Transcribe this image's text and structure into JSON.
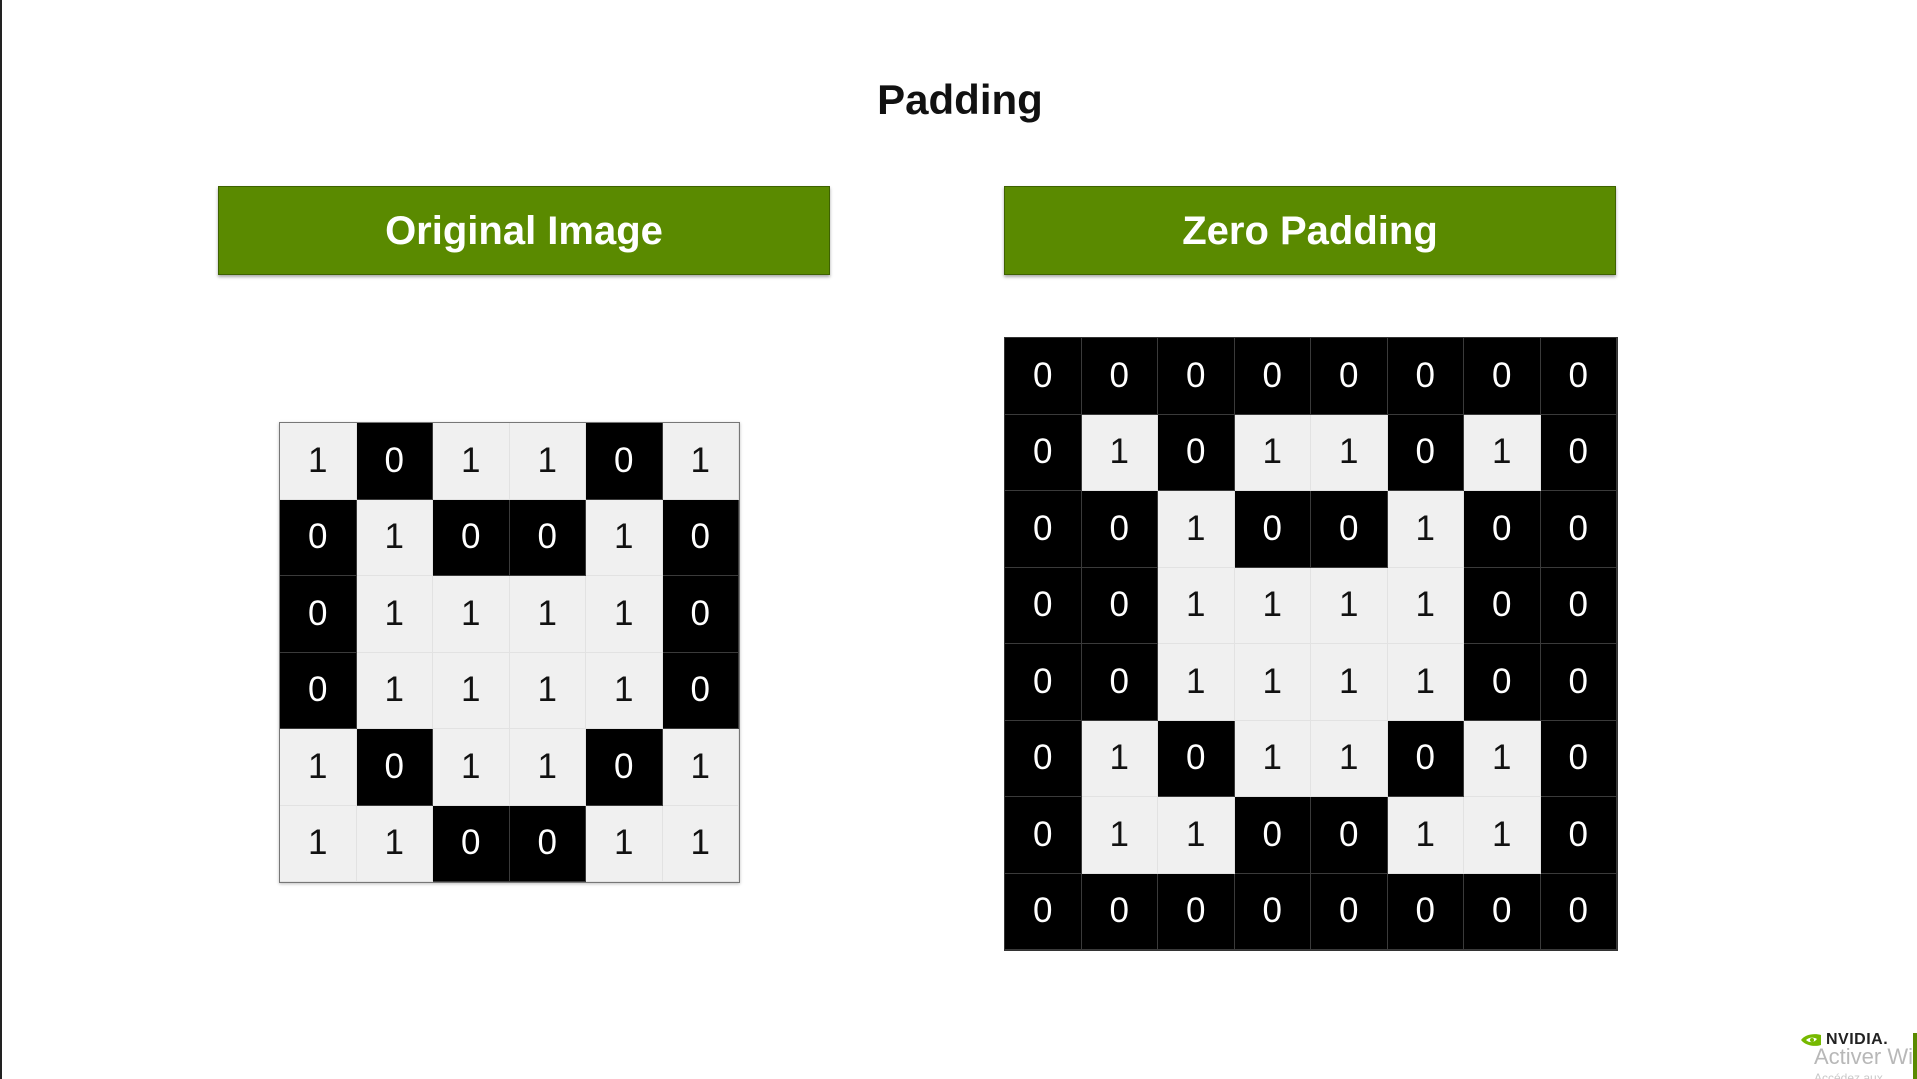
{
  "title": "Padding",
  "panels": {
    "original": {
      "label": "Original Image",
      "matrix": [
        [
          1,
          0,
          1,
          1,
          0,
          1
        ],
        [
          0,
          1,
          0,
          0,
          1,
          0
        ],
        [
          0,
          1,
          1,
          1,
          1,
          0
        ],
        [
          0,
          1,
          1,
          1,
          1,
          0
        ],
        [
          1,
          0,
          1,
          1,
          0,
          1
        ],
        [
          1,
          1,
          0,
          0,
          1,
          1
        ]
      ]
    },
    "zero_padding": {
      "label": "Zero Padding",
      "matrix": [
        [
          0,
          0,
          0,
          0,
          0,
          0,
          0,
          0
        ],
        [
          0,
          1,
          0,
          1,
          1,
          0,
          1,
          0
        ],
        [
          0,
          0,
          1,
          0,
          0,
          1,
          0,
          0
        ],
        [
          0,
          0,
          1,
          1,
          1,
          1,
          0,
          0
        ],
        [
          0,
          0,
          1,
          1,
          1,
          1,
          0,
          0
        ],
        [
          0,
          1,
          0,
          1,
          1,
          0,
          1,
          0
        ],
        [
          0,
          1,
          1,
          0,
          0,
          1,
          1,
          0
        ],
        [
          0,
          0,
          0,
          0,
          0,
          0,
          0,
          0
        ]
      ]
    }
  },
  "colors": {
    "banner_green": "#5a8a00",
    "zero_cell": "#000000",
    "one_cell": "#f0f0f0"
  },
  "footer": {
    "logo_text": "NVIDIA.",
    "logo_icon": "nvidia-eye-icon",
    "watermark": "Activer Win",
    "watermark_sub": "Accédez aux"
  }
}
